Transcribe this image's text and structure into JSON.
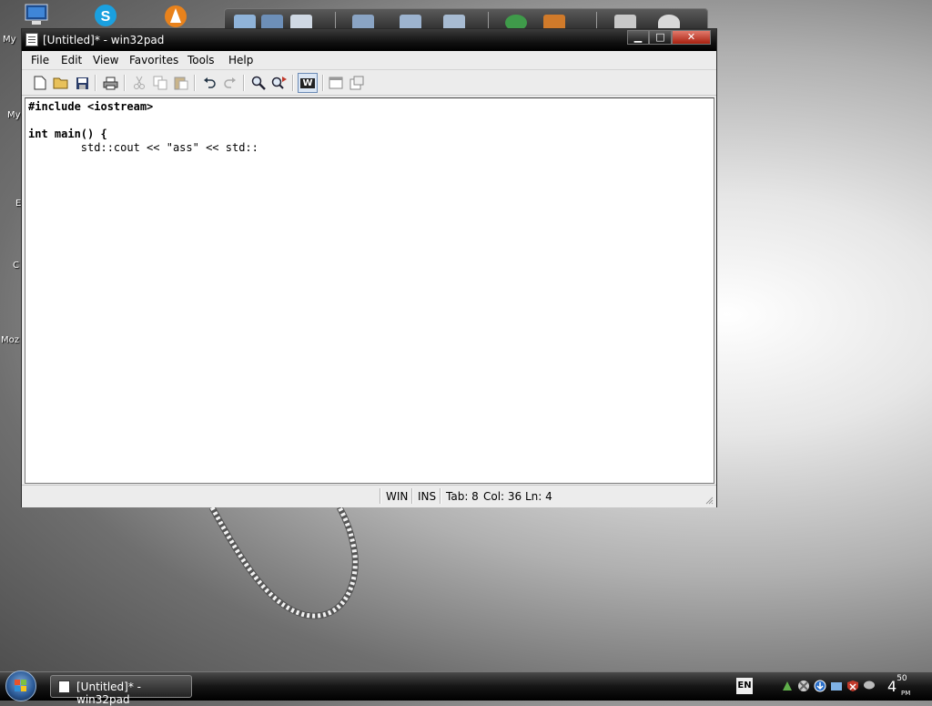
{
  "desktop": {
    "labels": [
      "My",
      "My",
      "E",
      "C",
      "Moz"
    ]
  },
  "window": {
    "title": "[Untitled]* - win32pad",
    "buttons": {
      "minimize": "▁",
      "maximize": "□",
      "close": "✕"
    },
    "menu": [
      "File",
      "Edit",
      "View",
      "Favorites",
      "Tools",
      "Help"
    ],
    "toolbar": {
      "wrap_label": "W"
    },
    "editor": {
      "lines": [
        "#include <iostream>",
        "",
        "int main() {",
        "        std::cout << \"ass\" << std::"
      ]
    },
    "status": {
      "encoding": "WIN",
      "mode": "INS",
      "tab": "Tab: 8",
      "position": "Col: 36 Ln: 4"
    }
  },
  "taskbar": {
    "task_label": "[Untitled]* - win32pad",
    "language": "EN",
    "clock_hour": "4",
    "clock_minutes": "50",
    "clock_ampm": "PM"
  }
}
